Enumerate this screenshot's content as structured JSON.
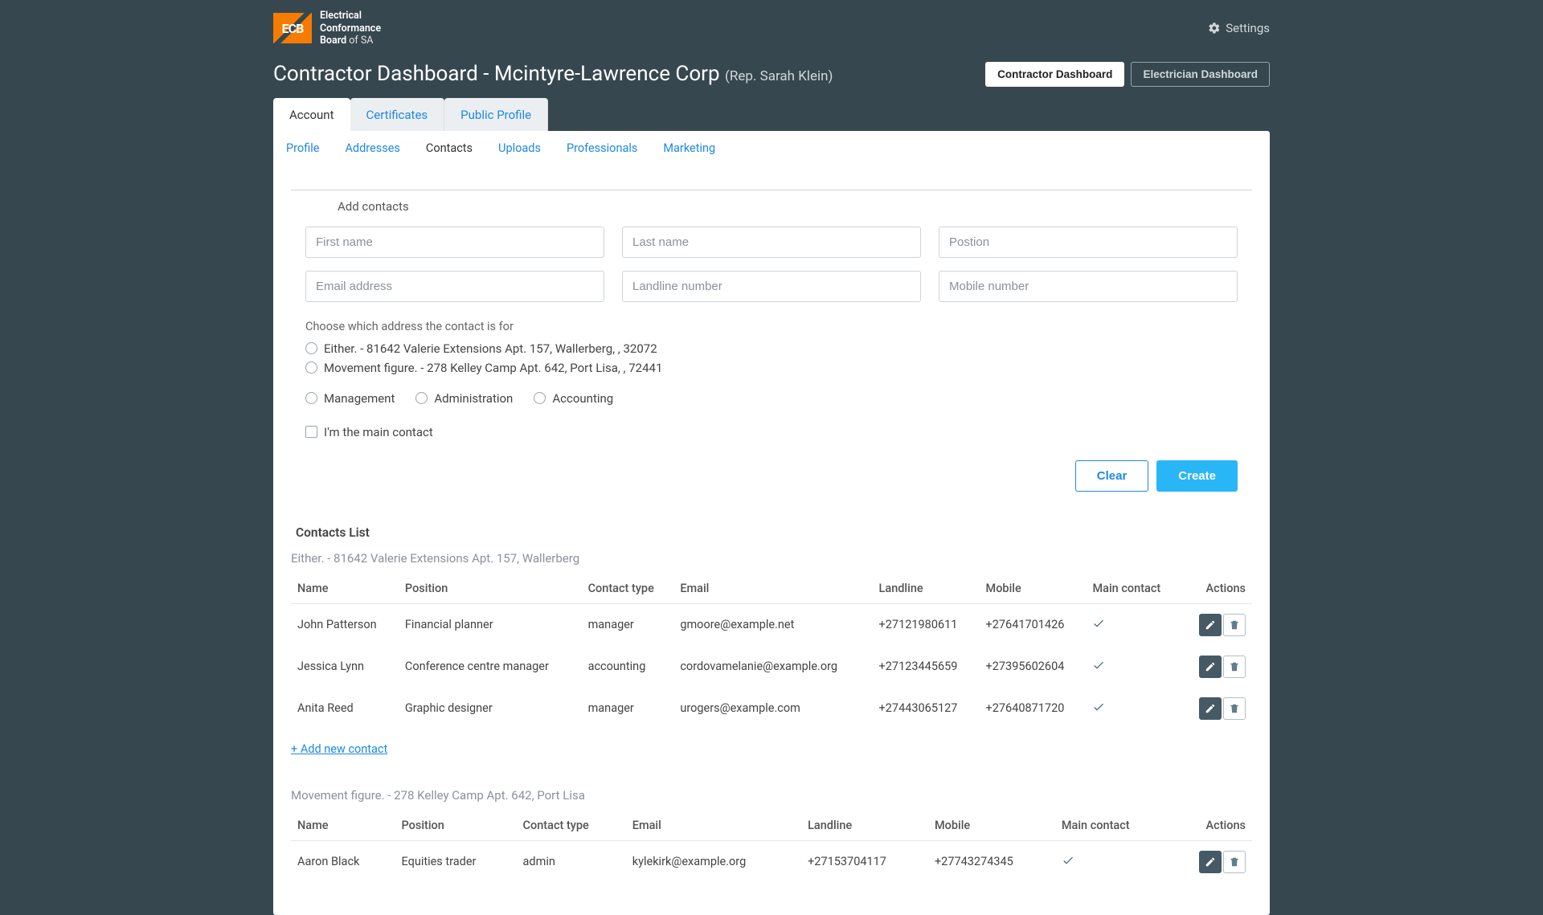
{
  "brand": {
    "name_l1": "Electrical",
    "name_l2": "Conformance",
    "name_l3_a": "Board",
    "name_l3_b": "of SA",
    "mark": "ECB"
  },
  "settings_label": "Settings",
  "header": {
    "title": "Contractor Dashboard - Mcintyre-Lawrence Corp",
    "rep": "(Rep. Sarah Klein)",
    "dash_buttons": {
      "contractor": "Contractor Dashboard",
      "electrician": "Electrician Dashboard"
    }
  },
  "main_tabs": {
    "account": "Account",
    "certificates": "Certificates",
    "public_profile": "Public Profile"
  },
  "sub_tabs": {
    "profile": "Profile",
    "addresses": "Addresses",
    "contacts": "Contacts",
    "uploads": "Uploads",
    "professionals": "Professionals",
    "marketing": "Marketing"
  },
  "form": {
    "legend": "Add contacts",
    "placeholders": {
      "first_name": "First name",
      "last_name": "Last name",
      "position": "Postion",
      "email": "Email address",
      "landline": "Landline number",
      "mobile": "Mobile number"
    },
    "address_helper": "Choose which address the contact is for",
    "addresses": [
      "Either. - 81642 Valerie Extensions Apt. 157, Wallerberg, , 32072",
      "Movement figure. - 278 Kelley Camp Apt. 642, Port Lisa, , 72441"
    ],
    "roles": {
      "management": "Management",
      "administration": "Administration",
      "accounting": "Accounting"
    },
    "main_contact_label": "I'm the main contact",
    "buttons": {
      "clear": "Clear",
      "create": "Create"
    }
  },
  "contacts_list": {
    "title": "Contacts List",
    "columns": {
      "name": "Name",
      "position": "Position",
      "contact_type": "Contact type",
      "email": "Email",
      "landline": "Landline",
      "mobile": "Mobile",
      "main_contact": "Main contact",
      "actions": "Actions"
    },
    "add_link": "+ Add new contact",
    "groups": [
      {
        "heading": "Either. - 81642 Valerie Extensions Apt. 157, Wallerberg",
        "rows": [
          {
            "name": "John Patterson",
            "position": "Financial planner",
            "contact_type": "manager",
            "email": "gmoore@example.net",
            "landline": "+27121980611",
            "mobile": "+27641701426",
            "main": true
          },
          {
            "name": "Jessica Lynn",
            "position": "Conference centre manager",
            "contact_type": "accounting",
            "email": "cordovamelanie@example.org",
            "landline": "+27123445659",
            "mobile": "+27395602604",
            "main": true
          },
          {
            "name": "Anita Reed",
            "position": "Graphic designer",
            "contact_type": "manager",
            "email": "urogers@example.com",
            "landline": "+27443065127",
            "mobile": "+27640871720",
            "main": true
          }
        ]
      },
      {
        "heading": "Movement figure. - 278 Kelley Camp Apt. 642, Port Lisa",
        "rows": [
          {
            "name": "Aaron Black",
            "position": "Equities trader",
            "contact_type": "admin",
            "email": "kylekirk@example.org",
            "landline": "+27153704117",
            "mobile": "+27743274345",
            "main": true
          }
        ]
      }
    ]
  }
}
